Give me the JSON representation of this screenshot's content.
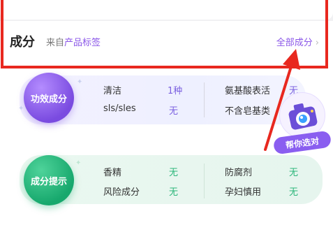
{
  "header": {
    "title": "成分",
    "source_prefix": "来自",
    "source_link": "产品标签",
    "all_link": "全部成分",
    "chevron": "›"
  },
  "effect": {
    "badge": "功效成分",
    "rows": [
      {
        "name": "清洁",
        "value": "1种"
      },
      {
        "name": "sls/sles",
        "value": "无"
      }
    ],
    "rows_right": [
      {
        "name": "氨基酸表活",
        "value": "无"
      },
      {
        "name": "不含皂基类",
        "value": ""
      }
    ]
  },
  "hint": {
    "badge": "成分提示",
    "rows": [
      {
        "name": "香精",
        "value": "无"
      },
      {
        "name": "风险成分",
        "value": "无"
      }
    ],
    "rows_right": [
      {
        "name": "防腐剂",
        "value": "无"
      },
      {
        "name": "孕妇慎用",
        "value": "无"
      }
    ]
  },
  "camera_widget": {
    "label": "帮你选对",
    "icon": "camera-icon"
  },
  "colors": {
    "highlight": "#e8281f",
    "accent_purple": "#8b57e8",
    "accent_green": "#2bb67a"
  }
}
